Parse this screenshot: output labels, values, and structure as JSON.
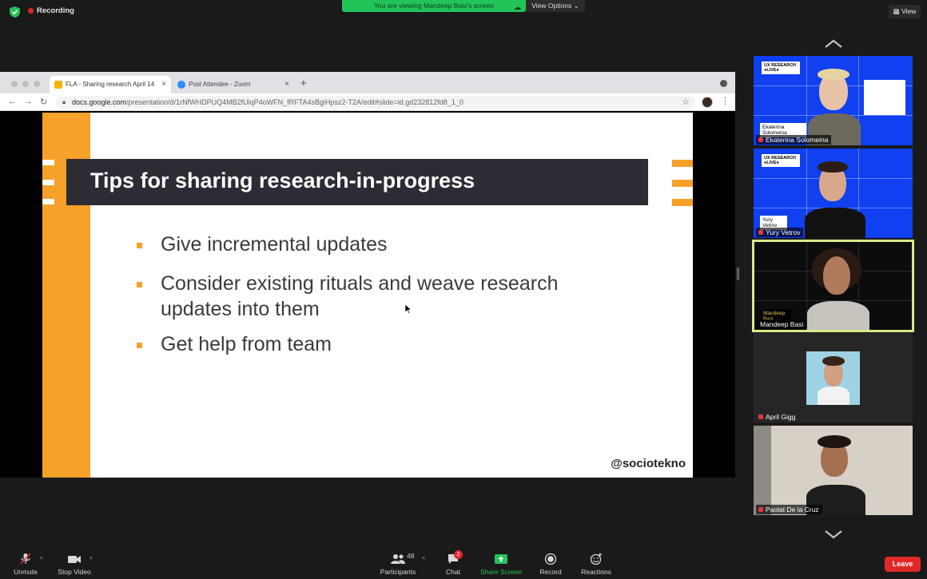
{
  "topbar": {
    "recording_label": "Recording",
    "viewing_banner": "You are viewing Mandeep Basi's screen",
    "view_options_label": "View Options ⌄",
    "view_label": "View"
  },
  "browser": {
    "tabs": [
      {
        "label": "FLA - Sharing research April 14",
        "active": true
      },
      {
        "label": "Post Attendee - Zoom",
        "active": false
      }
    ],
    "url_domain": "docs.google.com",
    "url_path": "/presentation/d/1rNfWHDPUQ4MB2fUlqP4oWFN_fRFTA4sBgiHpsz2-T2A/edit#slide=id.gd232812fd8_1_0"
  },
  "slide": {
    "title": "Tips for sharing research-in-progress",
    "bullets": [
      {
        "line1": "Give incremental updates",
        "line2": ""
      },
      {
        "line1": "Consider existing rituals and weave research",
        "line2": "updates into them"
      },
      {
        "line1": "Get help from team",
        "line2": ""
      }
    ],
    "handle": "@sociotekno"
  },
  "participants": [
    {
      "name": "Ekaterina Solomeina",
      "muted": true,
      "card": "Ekaterina Solomeina",
      "promo": "UX RESEARCH ●LIVE●"
    },
    {
      "name": "Yury Vetrov",
      "muted": true,
      "card": "Yury Vetrov",
      "promo": "UX RESEARCH ●LIVE●"
    },
    {
      "name": "Mandeep Basi",
      "muted": false,
      "card": "Mandeep Basi",
      "speaking": true
    },
    {
      "name": "April Gigg",
      "muted": true
    },
    {
      "name": "Paolat De la Cruz",
      "muted": true
    }
  ],
  "toolbar": {
    "unmute": "Unmute",
    "stop_video": "Stop Video",
    "participants": "Participants",
    "participants_count": "48",
    "chat": "Chat",
    "chat_badge": "2",
    "share_screen": "Share Screen",
    "record": "Record",
    "reactions": "Reactions",
    "leave": "Leave"
  },
  "colors": {
    "share_green": "#22c45a",
    "leave_red": "#e02828",
    "slide_orange": "#f5a12a",
    "speaking_border": "#d7ea8a"
  }
}
